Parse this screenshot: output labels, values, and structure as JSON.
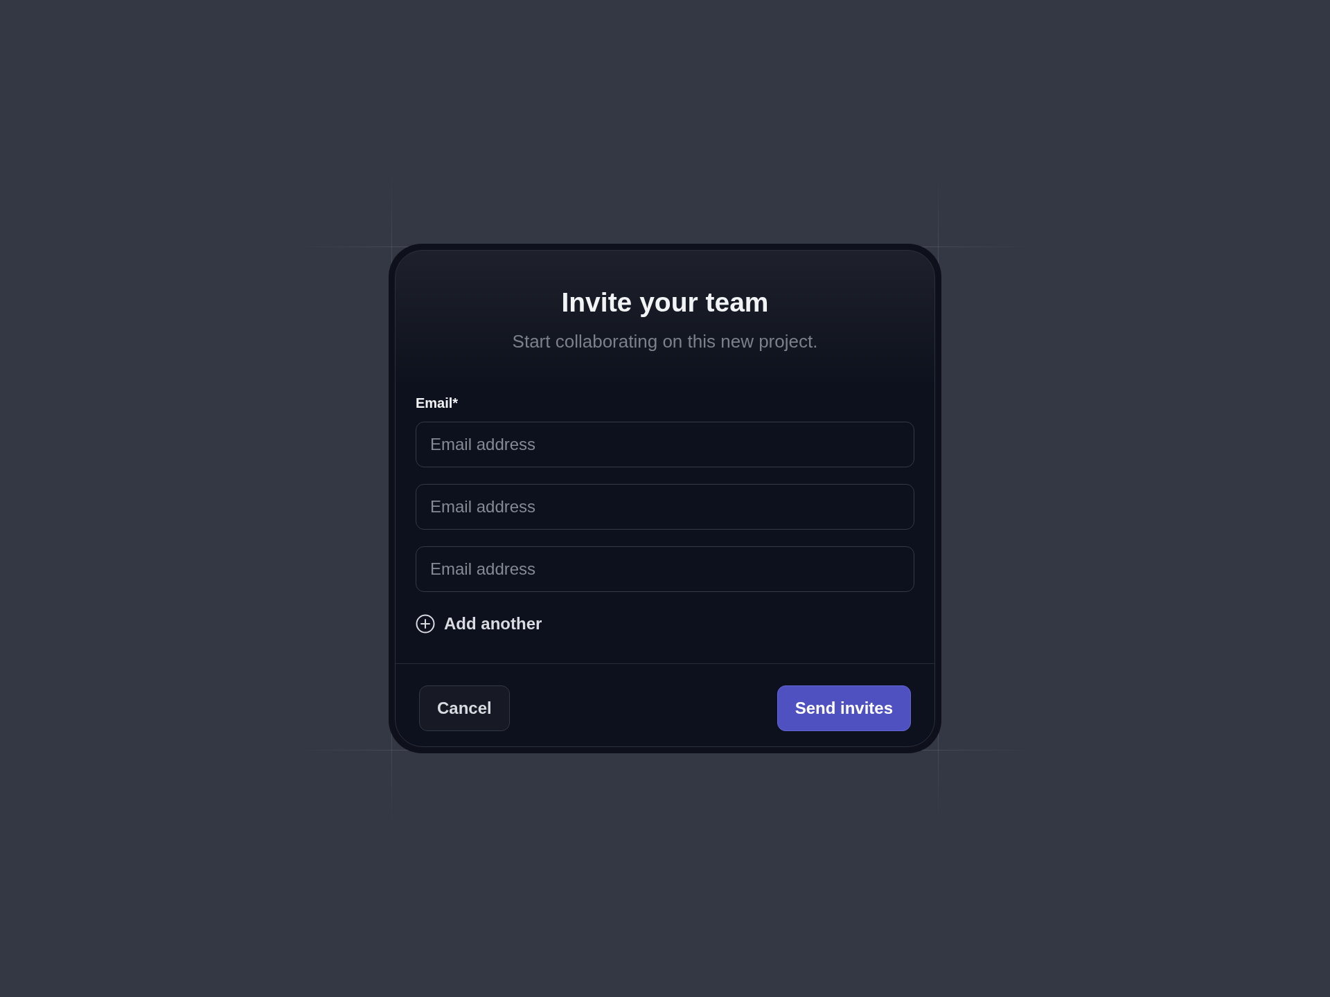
{
  "dialog": {
    "title": "Invite your team",
    "subtitle": "Start collaborating on this new project.",
    "email_label": "Email*",
    "email_fields": [
      {
        "placeholder": "Email address"
      },
      {
        "placeholder": "Email address"
      },
      {
        "placeholder": "Email address"
      }
    ],
    "add_link": "Add another",
    "buttons": [
      {
        "label": "Cancel",
        "kind": "secondary"
      },
      {
        "label": "Send invites",
        "kind": "primary"
      }
    ]
  }
}
